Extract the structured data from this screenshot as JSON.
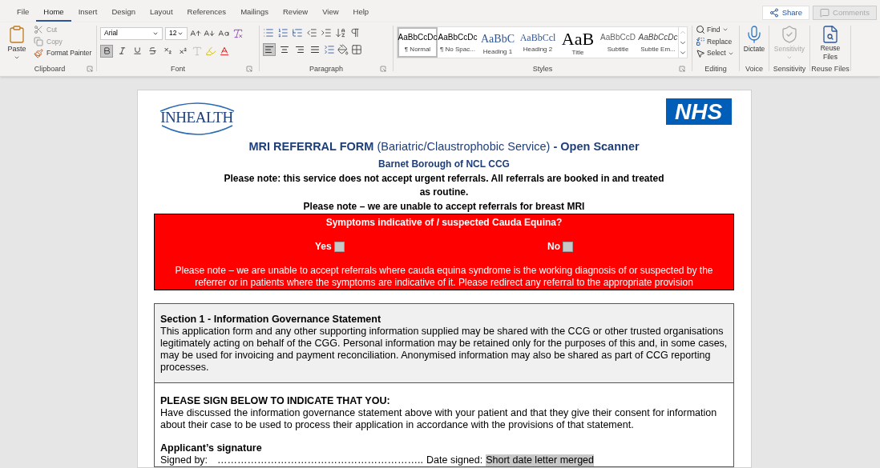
{
  "tabs": [
    {
      "label": "File",
      "selected": false
    },
    {
      "label": "Home",
      "selected": true
    },
    {
      "label": "Insert",
      "selected": false
    },
    {
      "label": "Design",
      "selected": false
    },
    {
      "label": "Layout",
      "selected": false
    },
    {
      "label": "References",
      "selected": false
    },
    {
      "label": "Mailings",
      "selected": false
    },
    {
      "label": "Review",
      "selected": false
    },
    {
      "label": "View",
      "selected": false
    },
    {
      "label": "Help",
      "selected": false
    }
  ],
  "share": "Share",
  "comments": {
    "label": "Comments",
    "disabled": true
  },
  "clipboard": {
    "paste": "Paste",
    "cut": "Cut",
    "copy": "Copy",
    "format_painter": "Format Painter",
    "label": "Clipboard"
  },
  "font": {
    "name": "Arial",
    "size": "12",
    "label": "Font",
    "toggles": [
      {
        "kind": "bold",
        "selected": true
      },
      {
        "kind": "italic",
        "selected": false
      },
      {
        "kind": "underline",
        "selected": false
      },
      {
        "kind": "strike",
        "selected": false
      },
      {
        "kind": "subscript",
        "selected": false
      },
      {
        "kind": "superscript",
        "selected": false
      }
    ]
  },
  "paragraph": {
    "label": "Paragraph",
    "align": [
      {
        "kind": "left",
        "selected": true
      },
      {
        "kind": "center",
        "selected": false
      },
      {
        "kind": "right",
        "selected": false
      },
      {
        "kind": "justify",
        "selected": false
      }
    ]
  },
  "styles": {
    "label": "Styles",
    "items": [
      {
        "preview": "AaBbCcDc",
        "label": "¶ Normal",
        "selected": true,
        "kind": "normal"
      },
      {
        "preview": "AaBbCcDc",
        "label": "¶ No Spac...",
        "selected": false,
        "kind": "normal"
      },
      {
        "preview": "AaBbC",
        "label": "Heading 1",
        "selected": false,
        "kind": "heading1"
      },
      {
        "preview": "AaBbCcl",
        "label": "Heading 2",
        "selected": false,
        "kind": "heading2"
      },
      {
        "preview": "AaB",
        "label": "Title",
        "selected": false,
        "kind": "title"
      },
      {
        "preview": "AaBbCcD",
        "label": "Subtitle",
        "selected": false,
        "kind": "subtitle"
      },
      {
        "preview": "AaBbCcDc",
        "label": "Subtle Em...",
        "selected": false,
        "kind": "emphasis"
      }
    ]
  },
  "editing": {
    "find": "Find",
    "replace": "Replace",
    "select": "Select",
    "label": "Editing"
  },
  "voice": {
    "button": "Dictate",
    "label": "Voice"
  },
  "sensitivity": {
    "button": "Sensitivity",
    "label": "Sensitivity",
    "disabled": true
  },
  "reuse": {
    "button": "Reuse Files",
    "label": "Reuse Files"
  },
  "document": {
    "logo": "INHEALTH",
    "nhs": "NHS",
    "title": "**MRI REFERRAL FORM** (Bariatric/Claustrophobic Service) **- Open Scanner**",
    "subtitle": "Barnet Borough of NCL CCG",
    "notes": [
      "Please note: this service does not accept urgent referrals.  All referrals are booked in and treated as routine.",
      "Please note – we are unable to accept referrals for breast MRI"
    ],
    "alert": {
      "question": "Symptoms indicative of / suspected Cauda Equina?",
      "options": [
        {
          "label": "Yes",
          "checked": false
        },
        {
          "label": "No",
          "checked": false
        }
      ],
      "note": "Please note – we are unable to accept referrals where cauda equina syndrome is the working diagnosis of or suspected by the referrer or in patients where the symptoms are indicative of it. Please redirect any referral to the appropriate provision"
    },
    "section1": {
      "heading": "Section 1 - Information Governance Statement",
      "body": "This application form and any other supporting information supplied may be shared with the CCG or other trusted organisations legitimately acting on behalf of the CGG.  Personal information may be retained only for the purposes of this and, in some cases, may be used for invoicing and payment reconciliation. Anonymised information may also be shared as part of CCG reporting processes."
    },
    "sign": {
      "heading": "PLEASE SIGN BELOW TO INDICATE THAT YOU:",
      "body": "Have discussed the information governance statement above with your patient and that they give their consent for information about their case to be used to process their application in accordance with the provisions of that statement.",
      "signature_heading": "Applicant’s signature",
      "signed_by": "Signed by:",
      "dots": "……………………………………………………..",
      "date_label": "Date signed:",
      "date_value": "Short date letter merged"
    }
  }
}
